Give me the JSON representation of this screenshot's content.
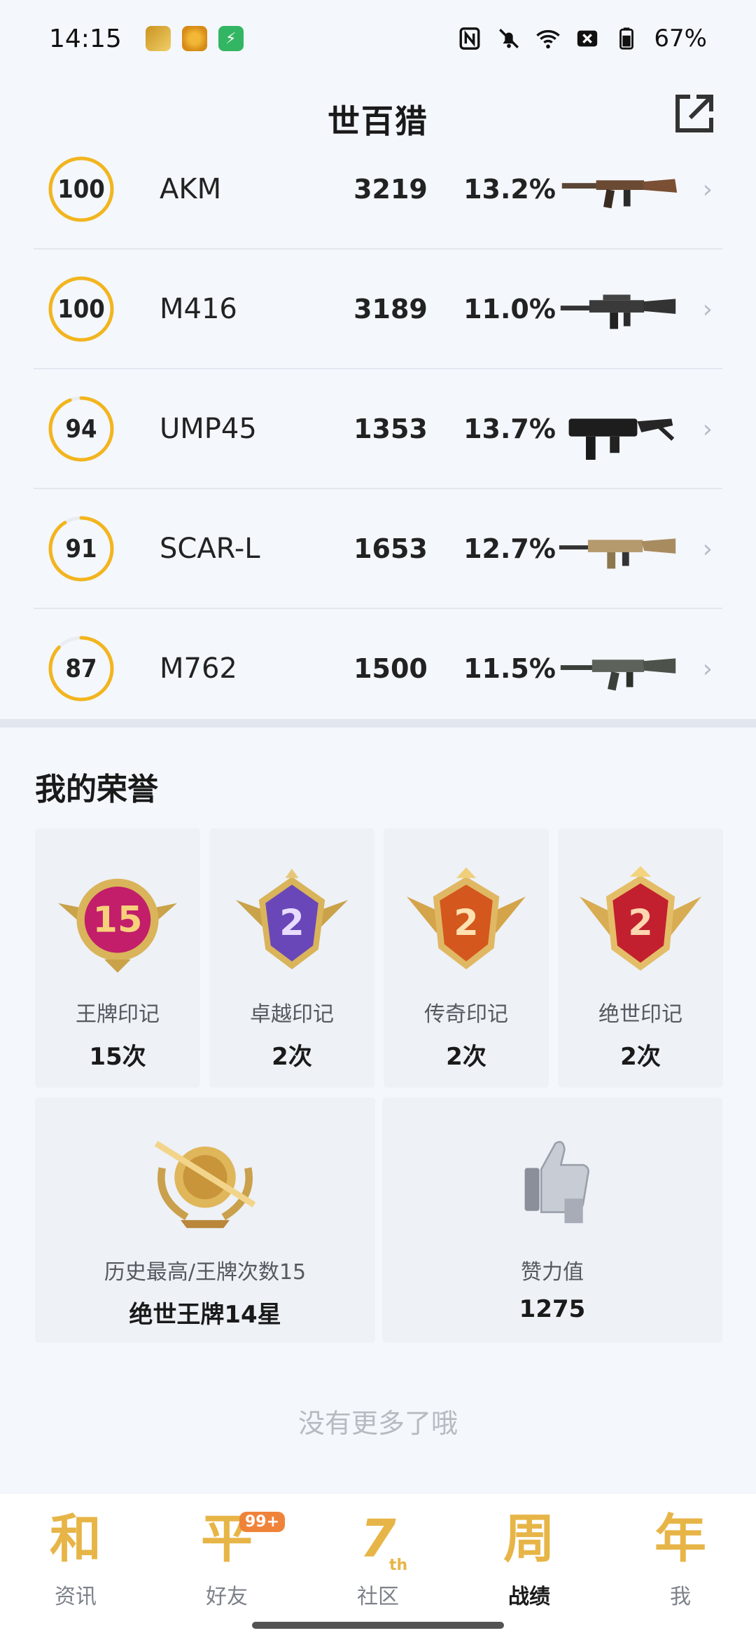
{
  "status_bar": {
    "time": "14:15",
    "battery": "67%",
    "icons": [
      "nfc-icon",
      "mute-icon",
      "wifi-icon",
      "sim-off-icon",
      "battery-icon"
    ]
  },
  "header": {
    "title": "世百猎",
    "share_icon": "share-external-icon"
  },
  "weapons": [
    {
      "score": "100",
      "score_value": 100,
      "name": "AKM",
      "count": "3219",
      "rate": "13.2%"
    },
    {
      "score": "100",
      "score_value": 100,
      "name": "M416",
      "count": "3189",
      "rate": "11.0%"
    },
    {
      "score": "94",
      "score_value": 94,
      "name": "UMP45",
      "count": "1353",
      "rate": "13.7%"
    },
    {
      "score": "91",
      "score_value": 91,
      "name": "SCAR-L",
      "count": "1653",
      "rate": "12.7%"
    },
    {
      "score": "87",
      "score_value": 87,
      "name": "M762",
      "count": "1500",
      "rate": "11.5%"
    }
  ],
  "honor": {
    "title": "我的荣誉",
    "marks": [
      {
        "badge_text": "15",
        "label": "王牌印记",
        "value": "15次",
        "color": "#c21e6a"
      },
      {
        "badge_text": "2",
        "label": "卓越印记",
        "value": "2次",
        "color": "#6a47b8"
      },
      {
        "badge_text": "2",
        "label": "传奇印记",
        "value": "2次",
        "color": "#d4571e"
      },
      {
        "badge_text": "2",
        "label": "绝世印记",
        "value": "2次",
        "color": "#c2202e"
      }
    ],
    "highest": {
      "label": "历史最高/王牌次数15",
      "value": "绝世王牌14星"
    },
    "likes": {
      "label": "赞力值",
      "value": "1275"
    }
  },
  "footer_text": "没有更多了哦",
  "tabs": [
    {
      "glyph": "和",
      "label": "资讯",
      "active": false
    },
    {
      "glyph": "平",
      "label": "好友",
      "badge": "99+",
      "active": false
    },
    {
      "glyph": "7",
      "sup": "th",
      "label": "社区",
      "active": false
    },
    {
      "glyph": "周",
      "label": "战绩",
      "active": true
    },
    {
      "glyph": "年",
      "label": "我",
      "active": false
    }
  ],
  "colors": {
    "ring": "#f2b51e",
    "ring_track": "#e9ecf1",
    "accent_gold": "#e7b547"
  }
}
